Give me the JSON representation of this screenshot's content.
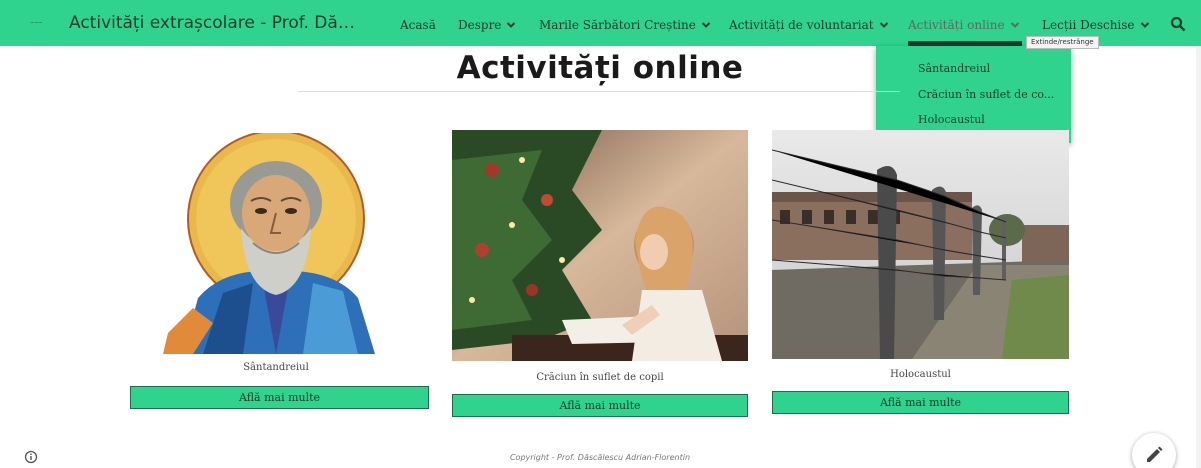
{
  "nav": {
    "logo_text": "~~~",
    "site_title": "Activități extrașcolare - Prof. Dăsc...",
    "items": [
      {
        "label": "Acasă",
        "has_dropdown": false
      },
      {
        "label": "Despre",
        "has_dropdown": true
      },
      {
        "label": "Marile Sărbători Creștine",
        "has_dropdown": true
      },
      {
        "label": "Activități de voluntariat",
        "has_dropdown": true
      },
      {
        "label": "Activități online",
        "has_dropdown": true,
        "active": true
      },
      {
        "label": "Lecții Deschise",
        "has_dropdown": true
      }
    ],
    "search_icon": "search-icon",
    "accent_color": "#2fd38d"
  },
  "tooltip": "Extinde/restrânge",
  "dropdown": {
    "items": [
      "Sântandreiul",
      "Crăciun în suflet de co...",
      "Holocaustul"
    ]
  },
  "page": {
    "title": "Activități online"
  },
  "cards": [
    {
      "caption": "Sântandreiul",
      "button": "Află mai multe",
      "image": "icon of St. Andrew with halo"
    },
    {
      "caption": "Crăciun în suflet de copil",
      "button": "Află mai multe",
      "image": "child writing by Christmas tree"
    },
    {
      "caption": "Holocaustul",
      "button": "Află mai multe",
      "image": "barbed-wire fence and barracks"
    }
  ],
  "footer": {
    "copyright": "Copyright - Prof. Dăscălescu Adrian-Florentin"
  },
  "icons": {
    "info": "info-icon",
    "edit": "pencil-icon"
  }
}
